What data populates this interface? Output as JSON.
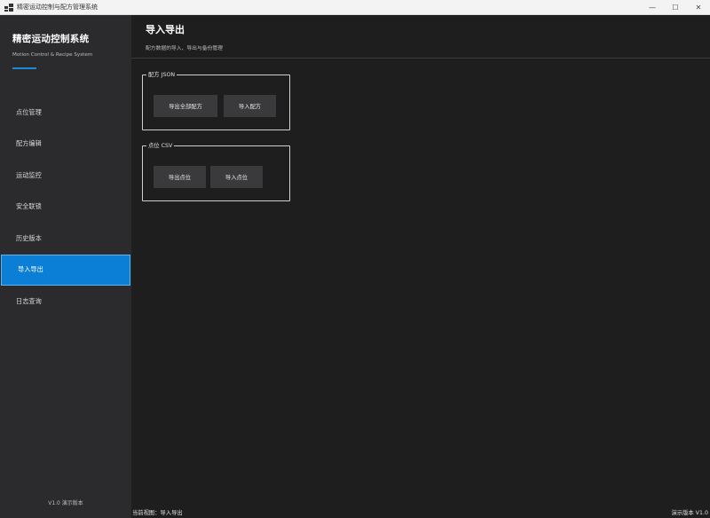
{
  "window": {
    "title": "精密运动控制与配方管理系统",
    "controls": {
      "minimize": "—",
      "maximize": "☐",
      "close": "✕"
    }
  },
  "sidebar": {
    "brand_title": "精密运动控制系统",
    "brand_subtitle": "Motion Control & Recipe System",
    "accent_color": "#1a8ad8",
    "items": [
      {
        "label": "点位管理",
        "active": false
      },
      {
        "label": "配方编辑",
        "active": false
      },
      {
        "label": "运动监控",
        "active": false
      },
      {
        "label": "安全联锁",
        "active": false
      },
      {
        "label": "历史版本",
        "active": false
      },
      {
        "label": "导入导出",
        "active": true
      },
      {
        "label": "日志查询",
        "active": false
      }
    ],
    "version": "V1.0 演示版本"
  },
  "main": {
    "title": "导入导出",
    "subtitle": "配方数据的导入、导出与备份管理",
    "groups": [
      {
        "legend": "配方 JSON",
        "buttons": [
          "导出全部配方",
          "导入配方"
        ]
      },
      {
        "legend": "点位 CSV",
        "buttons": [
          "导出点位",
          "导入点位"
        ]
      }
    ]
  },
  "statusbar": {
    "left": "当前视图：导入导出",
    "right": "演示版本 V1.0"
  }
}
